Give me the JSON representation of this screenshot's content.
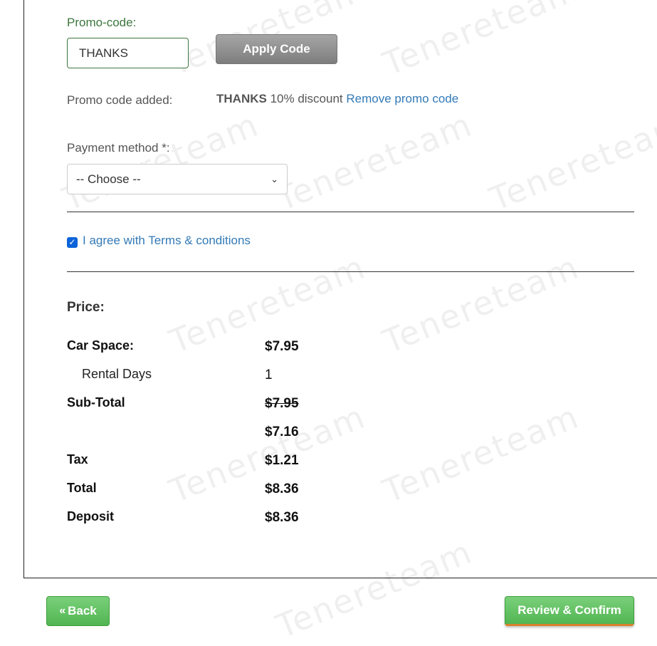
{
  "promo": {
    "label": "Promo-code:",
    "input_value": "THANKS",
    "apply_label": "Apply Code",
    "added_label": "Promo code added:",
    "added_code": "THANKS",
    "added_discount": "10% discount",
    "remove_label": "Remove promo code"
  },
  "payment": {
    "label": "Payment method *:",
    "selected": "-- Choose --"
  },
  "terms": {
    "checked": true,
    "label": "I agree with Terms & conditions"
  },
  "price": {
    "title": "Price:",
    "car_space_label": "Car Space:",
    "car_space_value": "$7.95",
    "rental_days_label": "Rental Days",
    "rental_days_value": "1",
    "subtotal_label": "Sub-Total",
    "subtotal_original": "$7.95",
    "subtotal_discounted": "$7.16",
    "tax_label": "Tax",
    "tax_value": "$1.21",
    "total_label": "Total",
    "total_value": "$8.36",
    "deposit_label": "Deposit",
    "deposit_value": "$8.36"
  },
  "footer": {
    "back_label": "Back",
    "confirm_label": "Review & Confirm"
  },
  "watermark": "Tenereteam",
  "colors": {
    "link": "#337ab7",
    "success": "#5cb85c",
    "label_green": "#3c763d",
    "checkbox": "#0b63d9"
  }
}
